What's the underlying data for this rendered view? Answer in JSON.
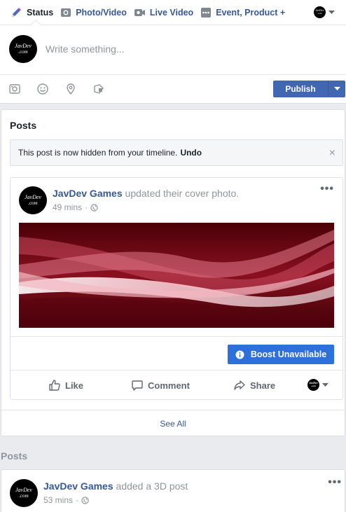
{
  "composer": {
    "tabs": [
      {
        "label": "Status"
      },
      {
        "label": "Photo/Video"
      },
      {
        "label": "Live Video"
      },
      {
        "label": "Event, Product +"
      }
    ],
    "placeholder": "Write something...",
    "publish_label": "Publish"
  },
  "page": {
    "avatar_line1": "JavDev",
    "avatar_line2": ".com"
  },
  "posts_section": {
    "title": "Posts",
    "hidden_notice": "This post is now hidden from your timeline.",
    "undo_label": "Undo",
    "close_glyph": "×",
    "see_all_label": "See All"
  },
  "post1": {
    "author": "JavDev Games",
    "action": "updated their cover photo.",
    "time": "49 mins",
    "separator": "·",
    "more_glyph": "•••",
    "boost_label": "Boost Unavailable",
    "like_label": "Like",
    "comment_label": "Comment",
    "share_label": "Share"
  },
  "posts_section_2": {
    "title": "Posts"
  },
  "post2": {
    "author": "JavDev Games",
    "action": "added a 3D post",
    "time": "53 mins",
    "separator": "·",
    "more_glyph": "•••"
  },
  "colors": {
    "brand_blue": "#4267b2",
    "boost_blue": "#2d6fdb",
    "link_blue": "#365899",
    "background": "#e9ebee"
  }
}
